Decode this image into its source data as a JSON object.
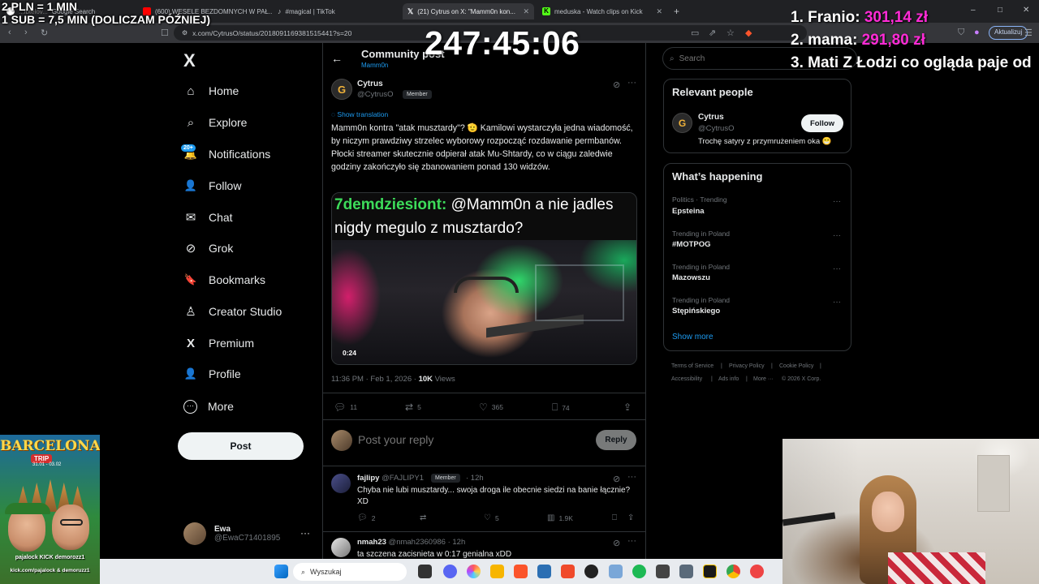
{
  "browser": {
    "tabs": [
      {
        "label": "Google Search",
        "prefix": "...lbtelov...",
        "active": false
      },
      {
        "label": "(600) WESELE BEZDOMNYCH W PAŁ...",
        "active": false
      },
      {
        "label": "#magical | TikTok",
        "active": false
      },
      {
        "label": "(21) Cytrus on X: \"Mamm0n kon...",
        "active": true
      },
      {
        "label": "meduska - Watch clips on Kick",
        "active": false
      }
    ],
    "new_tab": "+",
    "url": "x.com/CytrusO/status/2018091169381515441?s=20",
    "update_label": "Aktualizuj",
    "window_controls": [
      "–",
      "□",
      "✕"
    ]
  },
  "overlays": {
    "rate_line1": "2 PLN = 1 MIN",
    "rate_line2": "1 SUB = 7,5 MIN (DOLICZAM PÓŹNIEJ)",
    "timer": "247:45:06",
    "top3": [
      {
        "rank": "1.",
        "name": "Franio:",
        "amount": "301,14 zł"
      },
      {
        "rank": "2.",
        "name": "mama:",
        "amount": "291,80 zł"
      },
      {
        "rank": "3.",
        "name": "Mati Z Łodzi co ogląda paje od",
        "amount": ""
      }
    ]
  },
  "nav": {
    "logo": "X",
    "items": [
      {
        "label": "Home",
        "icon": "⌂"
      },
      {
        "label": "Explore",
        "icon": "⌕"
      },
      {
        "label": "Notifications",
        "icon": "🔔"
      },
      {
        "label": "Follow",
        "icon": "👤"
      },
      {
        "label": "Chat",
        "icon": "✉"
      },
      {
        "label": "Grok",
        "icon": "⊘"
      },
      {
        "label": "Bookmarks",
        "icon": "🔖"
      },
      {
        "label": "Creator Studio",
        "icon": "♙"
      },
      {
        "label": "Premium",
        "icon": "X"
      },
      {
        "label": "Profile",
        "icon": "👤"
      },
      {
        "label": "More",
        "icon": "⋯"
      }
    ],
    "notif_badge": "20+",
    "post_label": "Post",
    "account": {
      "name": "Ewa",
      "handle": "@EwaC71401895",
      "more": "···"
    }
  },
  "header": {
    "title": "Community post",
    "subtitle": "Mamm0n"
  },
  "tweet": {
    "name": "Cytrus",
    "handle": "@CytrusO",
    "member_badge": "Member",
    "show_translation": "Show translation",
    "text": "Mamm0n kontra \"atak musztardy\"? 🫡 Kamilowi wystarczyła jedna wiadomość, by niczym prawdziwy strzelec wyborowy rozpocząć rozdawanie permbanów. Płocki streamer skutecznie odpierał atak Mu-Shtardy, co w ciągu zaledwie godziny zakończyło się zbanowaniem ponad 130 widzów.",
    "video_caption_user": "7demdziesiont:",
    "video_caption_text": " @Mamm0n a nie jadles nigdy megulo z musztardo?",
    "video_time": "0:24",
    "time": "11:36 PM · Feb 1, 2026 · ",
    "views_count": "10K",
    "views_label": " Views",
    "actions": {
      "replies": "11",
      "reposts": "5",
      "likes": "365",
      "bookmarks": "74"
    }
  },
  "reply": {
    "placeholder": "Post your reply",
    "button": "Reply"
  },
  "comments": [
    {
      "name": "fajlipy",
      "handle": "@FAJLIPY1",
      "badge": "Member",
      "time": "· 12h",
      "text": "Chyba nie lubi musztardy... swoja droga ile obecnie siedzi na banie łącznie? XD",
      "replies": "2",
      "reposts": "",
      "likes": "5",
      "views": "1.9K"
    },
    {
      "name": "nmah23",
      "handle": "@nmah2360986",
      "time": "· 12h",
      "text": "ta szczena zacisnieta w 0:17 genialna xDD"
    }
  ],
  "right": {
    "search_placeholder": "Search",
    "relevant_title": "Relevant people",
    "relevant": {
      "name": "Cytrus",
      "handle": "@CytrusO",
      "bio": "Trochę satyry z przymrużeniem oka 😁",
      "follow": "Follow"
    },
    "happening_title": "What’s happening",
    "trends": [
      {
        "meta": "Politics · Trending",
        "name": "Epsteina"
      },
      {
        "meta": "Trending in Poland",
        "name": "#MOTPOG"
      },
      {
        "meta": "Trending in Poland",
        "name": "Mazowszu"
      },
      {
        "meta": "Trending in Poland",
        "name": "Stępińskiego"
      }
    ],
    "show_more": "Show more",
    "footer": [
      "Terms of Service",
      "|",
      "Privacy Policy",
      "|",
      "Cookie Policy",
      "|",
      "Accessibility",
      "|",
      "Ads info",
      "|",
      "More ···",
      "© 2026 X Corp."
    ]
  },
  "poster": {
    "title": "BARCELONA",
    "subtitle": "TRIP",
    "date": "31.01 - 03.02",
    "names": "pajalock   KICK   demorozz1",
    "kick": "kick.com/pajalock & demoruzz1"
  },
  "taskbar": {
    "search_placeholder": "Wyszukaj"
  },
  "colors": {
    "accent": "#1d9bf0",
    "overlay_amount": "#ff2bd6",
    "chat_user": "#3ddc5a"
  }
}
